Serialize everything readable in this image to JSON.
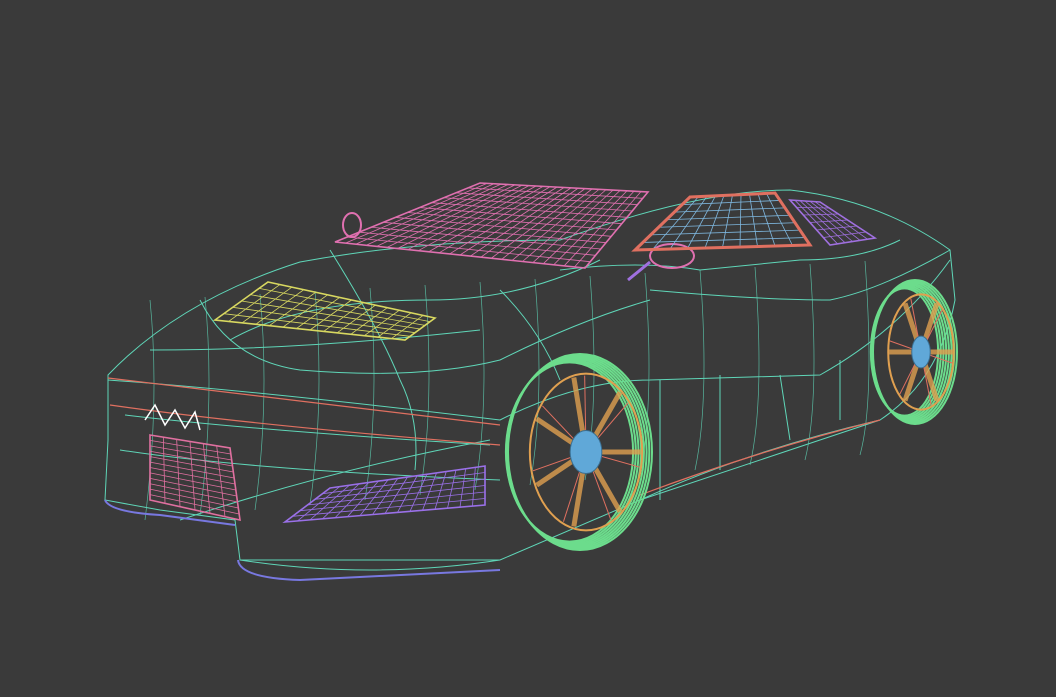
{
  "scene": {
    "background_color": "#3a3a3a",
    "colors": {
      "body": "#5fd6b8",
      "windshield": "#e070b0",
      "side_window": "#7fb8e0",
      "rear_window": "#a070e0",
      "hood_vent": "#d8d860",
      "grille": "#e070a0",
      "intake": "#9a70e8",
      "trim_red": "#e07060",
      "tire": "#6cdc8c",
      "rim": "#e0a050",
      "hub": "#60a8d8",
      "underbody": "#7878e0"
    }
  }
}
